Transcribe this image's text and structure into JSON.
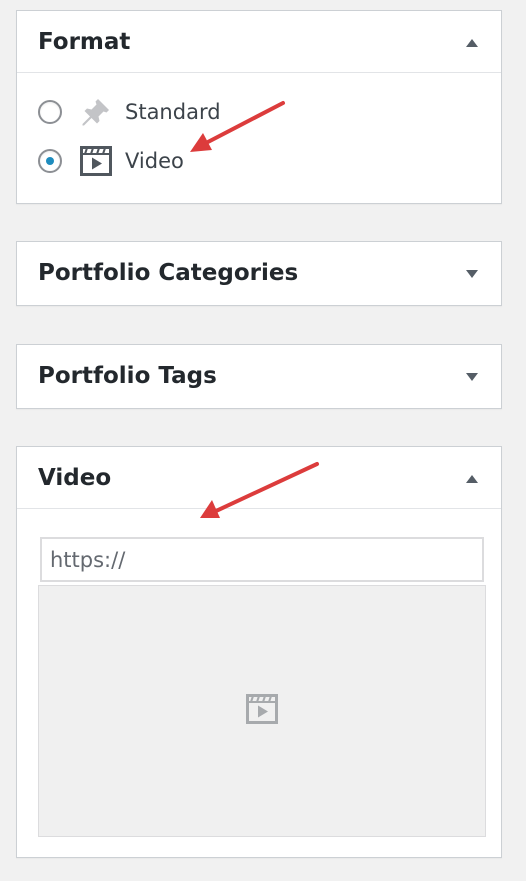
{
  "format_box": {
    "title": "Format",
    "toggle_icon": "arrow-up-icon",
    "options": [
      {
        "label": "Standard",
        "icon": "pin-icon",
        "checked": false
      },
      {
        "label": "Video",
        "icon": "video-icon",
        "checked": true
      }
    ]
  },
  "portfolio_categories_box": {
    "title": "Portfolio Categories",
    "toggle_icon": "arrow-down-icon"
  },
  "portfolio_tags_box": {
    "title": "Portfolio Tags",
    "toggle_icon": "arrow-down-icon"
  },
  "video_box": {
    "title": "Video",
    "toggle_icon": "arrow-up-icon",
    "url_placeholder": "https://",
    "url_value": "",
    "preview_icon": "video-icon"
  },
  "colors": {
    "background": "#f1f1f1",
    "panel": "#ffffff",
    "border": "#ccd0d4",
    "radio_checked": "#1e8cbe",
    "annotation_arrow": "#dc3c3c",
    "icon_gray": "#a7aaad"
  }
}
